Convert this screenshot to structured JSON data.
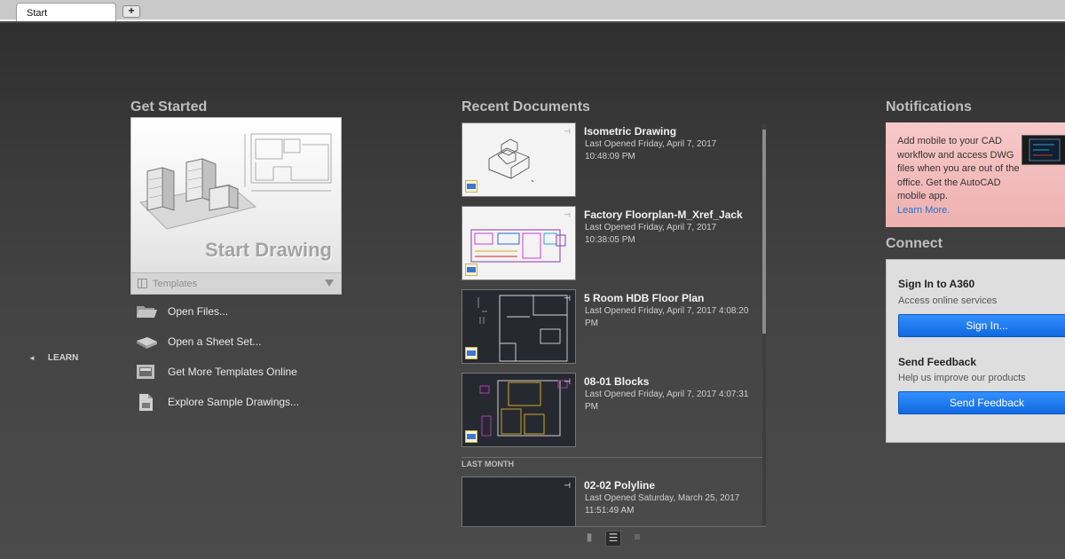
{
  "tabs": {
    "start": "Start",
    "add": "+"
  },
  "learn": {
    "arrow": "◄",
    "label": "LEARN"
  },
  "get_started": {
    "title": "Get Started",
    "start_drawing": "Start Drawing",
    "templates_label": "Templates",
    "actions": [
      {
        "label": "Open Files...",
        "icon": "folder-icon"
      },
      {
        "label": "Open a Sheet Set...",
        "icon": "sheet-set-icon"
      },
      {
        "label": "Get More Templates Online",
        "icon": "templates-online-icon"
      },
      {
        "label": "Explore Sample Drawings...",
        "icon": "sample-drawings-icon"
      }
    ]
  },
  "recent": {
    "title": "Recent Documents",
    "docs": [
      {
        "name": "Isometric Drawing",
        "line1": "Last Opened Friday, April 7, 2017",
        "line2": "10:48:09 PM"
      },
      {
        "name": "Factory Floorplan-M_Xref_Jack",
        "line1": "Last Opened Friday, April 7, 2017",
        "line2": "10:38:05 PM"
      },
      {
        "name": "5 Room HDB Floor Plan",
        "line1": "Last Opened Friday, April 7, 2017 4:08:20",
        "line2": "PM"
      },
      {
        "name": "08-01 Blocks",
        "line1": "Last Opened Friday, April 7, 2017 4:07:31",
        "line2": "PM"
      },
      {
        "name": "02-02 Polyline",
        "line1": "Last Opened Saturday, March 25, 2017",
        "line2": "11:51:49 AM"
      }
    ],
    "last_month": "LAST MONTH"
  },
  "notifications": {
    "title": "Notifications",
    "text": "Add mobile to your CAD workflow and access DWG files when you are out of the office. Get the AutoCAD mobile app.",
    "link": "Learn More."
  },
  "connect": {
    "title": "Connect",
    "signin_heading": "Sign In to A360",
    "signin_sub": "Access online services",
    "signin_button": "Sign In...",
    "feedback_heading": "Send Feedback",
    "feedback_sub": "Help us improve our products",
    "feedback_button": "Send Feedback"
  },
  "colors": {
    "accent_blue": "#1a7ae8",
    "notification_bg": "#f2bcbc",
    "background": "#444444"
  }
}
